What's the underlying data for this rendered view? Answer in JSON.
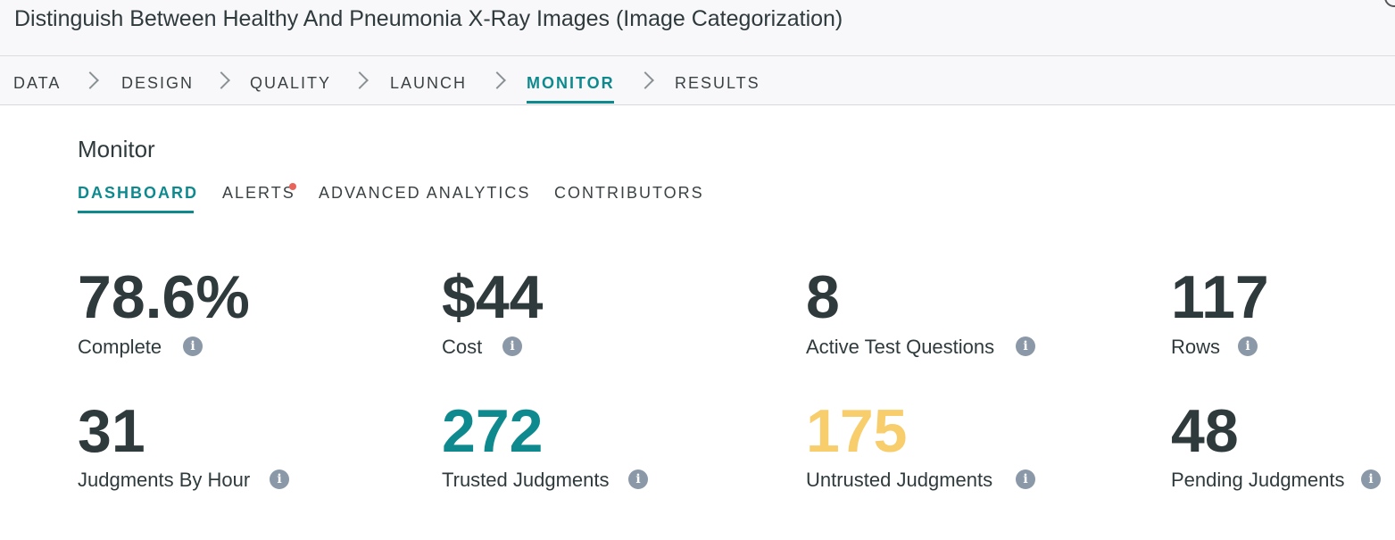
{
  "header": {
    "title": "Distinguish Between Healthy And Pneumonia X-Ray Images (Image Categorization)"
  },
  "steps": [
    "DATA",
    "DESIGN",
    "QUALITY",
    "LAUNCH",
    "MONITOR",
    "RESULTS"
  ],
  "active_step": "MONITOR",
  "section": {
    "title": "Monitor"
  },
  "tabs": [
    "DASHBOARD",
    "ALERTS",
    "ADVANCED ANALYTICS",
    "CONTRIBUTORS"
  ],
  "active_tab": "DASHBOARD",
  "metrics": [
    {
      "value": "78.6%",
      "label": "Complete"
    },
    {
      "value": "$44",
      "label": "Cost"
    },
    {
      "value": "8",
      "label": "Active Test Questions"
    },
    {
      "value": "117",
      "label": "Rows"
    },
    {
      "value": "31",
      "label": "Judgments By Hour"
    },
    {
      "value": "272",
      "label": "Trusted Judgments"
    },
    {
      "value": "175",
      "label": "Untrusted Judgments"
    },
    {
      "value": "48",
      "label": "Pending Judgments"
    }
  ],
  "info_icon_glyph": "i",
  "colors": {
    "accent": "#0e8a8f",
    "trusted": "#0e8a8f",
    "untrusted": "#f8cd6b",
    "alert_dot": "#e8645a",
    "info_icon": "#8a98a8"
  }
}
